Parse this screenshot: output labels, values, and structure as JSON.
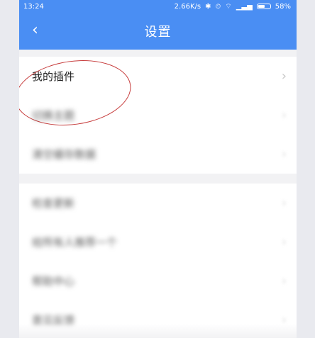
{
  "status_bar": {
    "time": "13:24",
    "speed": "2.66K/s",
    "battery_percent": "58%",
    "battery_level": 0.58
  },
  "header": {
    "title": "设置",
    "back_glyph": "‹"
  },
  "groups": [
    {
      "items": [
        {
          "label": "我的插件"
        },
        {
          "label": "切换主题"
        },
        {
          "label": "清空缓存数据"
        }
      ]
    },
    {
      "items": [
        {
          "label": "检查更新"
        },
        {
          "label": "给所有人推荐一个"
        },
        {
          "label": "帮助中心"
        },
        {
          "label": "意见反馈"
        }
      ]
    }
  ],
  "chevron_glyph": "›",
  "colors": {
    "header_bg": "#4a8ef3",
    "annotation_circle": "#c63a3a"
  }
}
